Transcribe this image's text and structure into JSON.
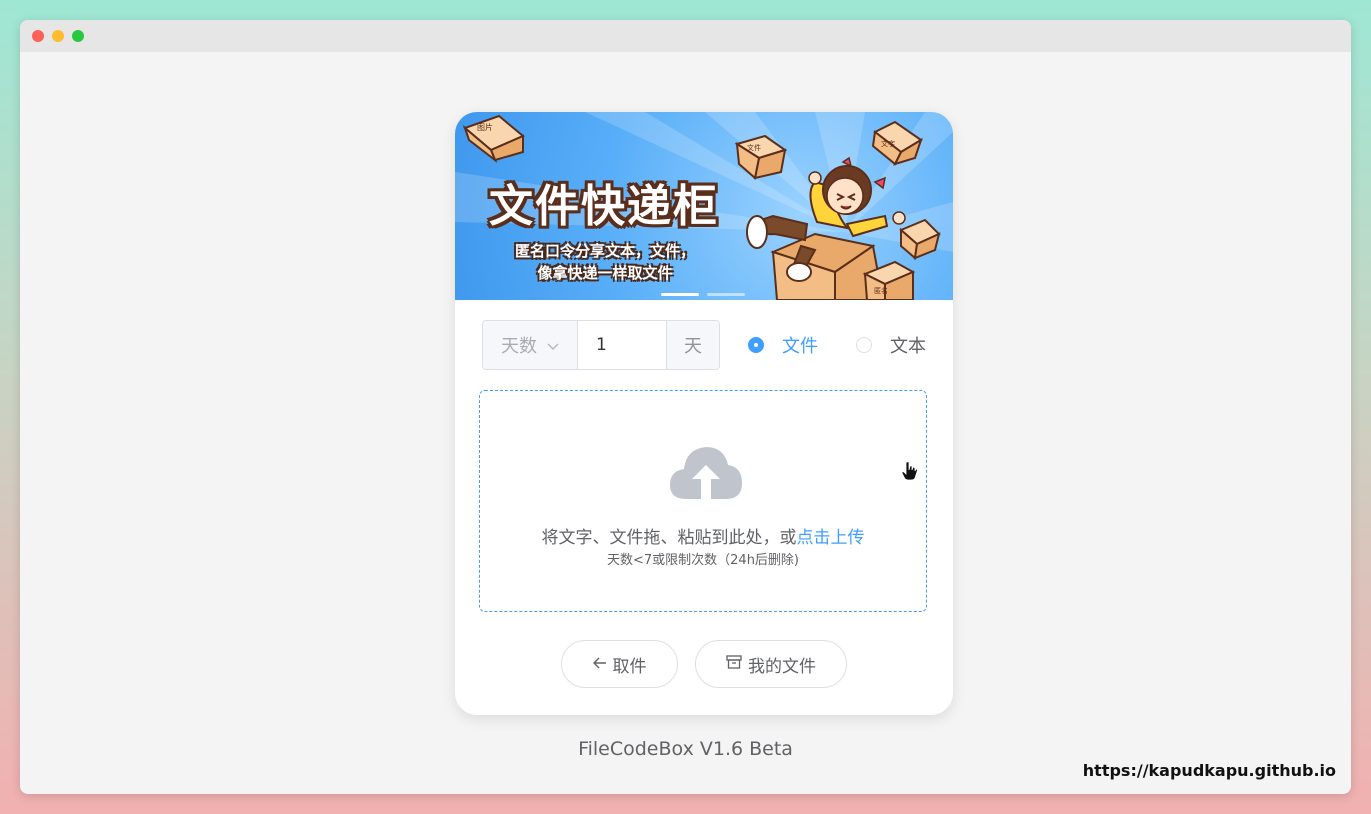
{
  "window": {
    "controls": [
      "close",
      "minimize",
      "maximize"
    ]
  },
  "banner": {
    "title": "文件快递柜",
    "subtitle_line1": "匿名口令分享文本，文件，",
    "subtitle_line2": "像拿快递一样取文件",
    "box_labels": [
      "图片",
      "文件",
      "文字",
      "匿名"
    ],
    "slides": 2,
    "active_slide": 1
  },
  "expire": {
    "type_label": "天数",
    "value": "1",
    "unit": "天"
  },
  "mode": {
    "options": [
      {
        "label": "文件",
        "checked": true
      },
      {
        "label": "文本",
        "checked": false
      }
    ]
  },
  "upload": {
    "icon": "upload-cloud-icon",
    "text": "将文字、文件拖、粘贴到此处，或",
    "link": "点击上传",
    "tip": "天数<7或限制次数（24h后删除)"
  },
  "actions": {
    "cancel_label": "取件",
    "my_files_label": "我的文件"
  },
  "footer": {
    "version": "FileCodeBox V1.6 Beta"
  },
  "watermark": "https://kapudkapu.github.io",
  "colors": {
    "accent": "#409eff",
    "background": "#f4f4f4"
  }
}
